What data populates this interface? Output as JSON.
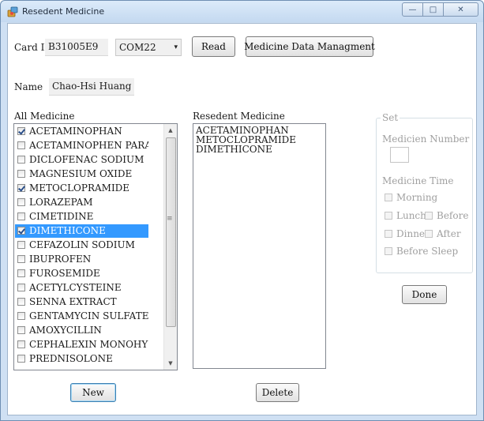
{
  "window": {
    "title": "Resedent Medicine",
    "controls": {
      "minimize": "—",
      "maximize": "□",
      "close": "✕"
    }
  },
  "card": {
    "label": "Card ID",
    "value": "B31005E9",
    "port": "COM22",
    "read_button": "Read",
    "data_button": "Medicine Data Managment"
  },
  "name": {
    "label": "Name",
    "value": "Chao-Hsi Huang"
  },
  "all_medicine": {
    "label": "All Medicine",
    "items": [
      {
        "label": "ACETAMINOPHAN",
        "checked": true,
        "selected": false
      },
      {
        "label": "ACETAMINOPHEN PARACE",
        "checked": false,
        "selected": false
      },
      {
        "label": "DICLOFENAC SODIUM",
        "checked": false,
        "selected": false
      },
      {
        "label": "MAGNESIUM OXIDE",
        "checked": false,
        "selected": false
      },
      {
        "label": "METOCLOPRAMIDE",
        "checked": true,
        "selected": false
      },
      {
        "label": "LORAZEPAM",
        "checked": false,
        "selected": false
      },
      {
        "label": "CIMETIDINE",
        "checked": false,
        "selected": false
      },
      {
        "label": "DIMETHICONE",
        "checked": true,
        "selected": true
      },
      {
        "label": "CEFAZOLIN SODIUM",
        "checked": false,
        "selected": false
      },
      {
        "label": "IBUPROFEN",
        "checked": false,
        "selected": false
      },
      {
        "label": "FUROSEMIDE",
        "checked": false,
        "selected": false
      },
      {
        "label": "ACETYLCYSTEINE",
        "checked": false,
        "selected": false
      },
      {
        "label": "SENNA EXTRACT",
        "checked": false,
        "selected": false
      },
      {
        "label": "GENTAMYCIN SULFATE",
        "checked": false,
        "selected": false
      },
      {
        "label": "AMOXYCILLIN",
        "checked": false,
        "selected": false
      },
      {
        "label": "CEPHALEXIN MONOHYDRA",
        "checked": false,
        "selected": false
      },
      {
        "label": "PREDNISOLONE",
        "checked": false,
        "selected": false
      }
    ],
    "new_button": "New"
  },
  "resident_medicine": {
    "label": "Resedent Medicine",
    "items": [
      "ACETAMINOPHAN",
      "METOCLOPRAMIDE",
      "DIMETHICONE"
    ],
    "delete_button": "Delete"
  },
  "set_panel": {
    "title": "Set",
    "number_label": "Medicien Number",
    "time_label": "Medicine Time",
    "morning": "Morning",
    "lunch": "Lunch",
    "before": "Before",
    "dinner": "Dinner",
    "after": "After",
    "before_sleep": "Before Sleep",
    "done_button": "Done"
  },
  "icons": {
    "app": "app-icon",
    "combo_arrow": "▾",
    "scroll_up": "▲",
    "scroll_down": "▼",
    "scroll_grip": "≡"
  },
  "colors": {
    "selection": "#3399ff",
    "frame": "#cfe0f3",
    "disabled_text": "#a0a0a0"
  }
}
